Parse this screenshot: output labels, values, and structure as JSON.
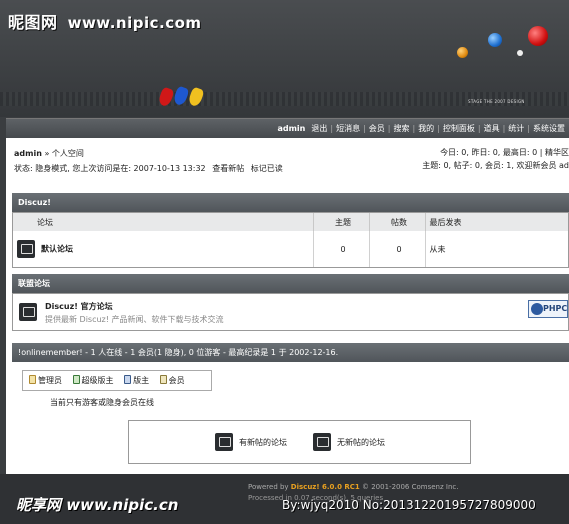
{
  "watermark": {
    "top_brand": "昵图网",
    "top_url": "www.nipic.com",
    "bottom_brand": "昵享网",
    "bottom_url": "www.nipic.cn",
    "bottom_id": "By:wjyq2010  No:20131220195727809000"
  },
  "banner": {
    "slogan": "STAGE THE 2007 DESIGN"
  },
  "nav": {
    "user": "admin",
    "items": [
      "退出",
      "短消息",
      "会员",
      "搜索",
      "我的",
      "控制面板",
      "道具",
      "统计",
      "系统设置"
    ]
  },
  "userinfo": {
    "line1_user": "admin",
    "line1_rest": " » 个人空间",
    "line2_status": "状态: 隐身模式, 您上次访问是在: 2007-10-13 13:32",
    "line2_links": [
      "查看新帖",
      "标记已读"
    ]
  },
  "stats": {
    "line1": "今日: 0, 昨日: 0, 最高日: 0 | 精华区",
    "line2": "主题: 0, 帖子: 0, 会员: 1, 欢迎新会员 ad"
  },
  "discuz_section": {
    "title": "Discuz!",
    "headers": {
      "forum": "论坛",
      "topics": "主题",
      "posts": "帖数",
      "last": "最后发表"
    },
    "rows": [
      {
        "name": "默认论坛",
        "topics": "0",
        "posts": "0",
        "last": "从未"
      }
    ]
  },
  "links_section": {
    "title": "联盟论坛",
    "name": "Discuz! 官方论坛",
    "desc": "提供最新 Discuz! 产品新闻、软件下载与技术交流",
    "badge": "PHPC"
  },
  "online_section": {
    "title": "!onlinemember! - 1 人在线 - 1 会员(1 隐身), 0 位游客 - 最高纪录是 1 于 2002-12-16.",
    "legend": [
      "管理员",
      "超级版主",
      "版主",
      "会员"
    ],
    "note": "当前只有游客或隐身会员在线"
  },
  "icon_key": {
    "new_posts": "有新帖的论坛",
    "no_new_posts": "无新帖的论坛"
  },
  "footer": {
    "powered_prefix": "Powered by ",
    "powered_brand": "Discuz! 6.0.0 RC1",
    "powered_suffix": " © 2001-2006 Comsenz Inc.",
    "processed": "Processed in 0.07 second(s), 5 queries"
  },
  "colors": {
    "banner_bg": "#3a3d40",
    "header_bar": "#50555a",
    "ball_blue": "#2e7fe0",
    "ball_red": "#e02020",
    "ball_yellow": "#f0c020"
  }
}
